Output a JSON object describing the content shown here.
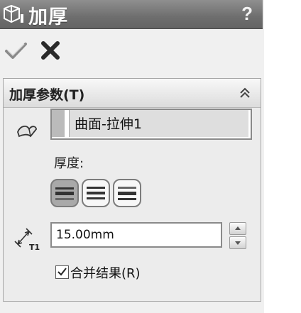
{
  "titlebar": {
    "title": "加厚",
    "help_label": "?"
  },
  "actions": {
    "ok_icon": "check-icon",
    "cancel_icon": "close-icon"
  },
  "group": {
    "title": "加厚参数(T)",
    "selection": {
      "value": "曲面-拉伸1"
    },
    "thickness": {
      "label": "厚度:",
      "options": [
        "side-1",
        "both-sides",
        "side-2"
      ],
      "selected": "side-1"
    },
    "thickness_value": {
      "value": "15.00mm",
      "icon": "dimension-t1-icon",
      "icon_label": "T1"
    },
    "merge": {
      "label": "合并结果(R)",
      "checked": true
    }
  },
  "colors": {
    "titlebar": "#6e6e6e",
    "panel": "#f0f0f0",
    "active_button": "#a9a9a9"
  }
}
